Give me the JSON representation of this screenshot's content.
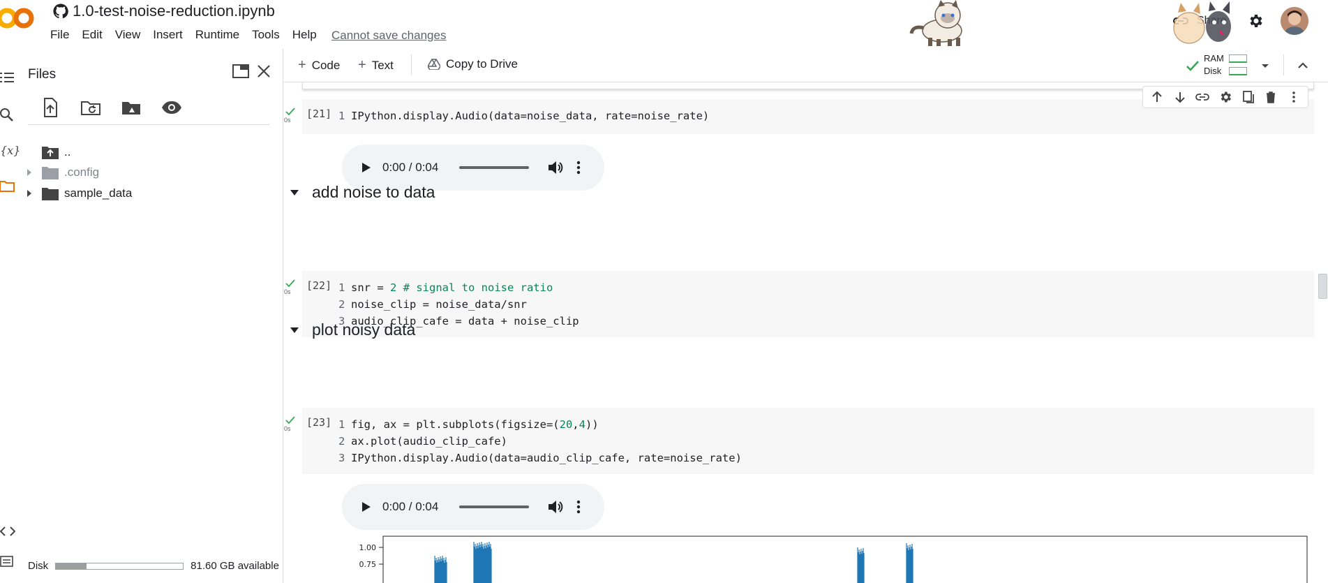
{
  "header": {
    "notebook_title": "1.0-test-noise-reduction.ipynb",
    "menu": [
      "File",
      "Edit",
      "View",
      "Insert",
      "Runtime",
      "Tools",
      "Help"
    ],
    "cannot_save": "Cannot save changes",
    "share_label": "Share"
  },
  "files_panel": {
    "title": "Files",
    "tree": [
      {
        "label": "..",
        "type": "parent"
      },
      {
        "label": ".config",
        "type": "folder-dim"
      },
      {
        "label": "sample_data",
        "type": "folder"
      }
    ],
    "disk_label": "Disk",
    "disk_available": "81.60 GB available",
    "disk_used_fraction": 0.24
  },
  "toolbar": {
    "code_label": "Code",
    "text_label": "Text",
    "copy_to_drive": "Copy to Drive",
    "ram_label": "RAM",
    "disk_label": "Disk"
  },
  "cells": {
    "c21": {
      "count": "[21]",
      "time": "0s",
      "lines": [
        "IPython.display.Audio(data=noise_data, rate=noise_rate)"
      ]
    },
    "audio1": {
      "time": "0:00 / 0:04"
    },
    "section1": "add noise to data",
    "c22": {
      "count": "[22]",
      "time": "0s",
      "lines": [
        {
          "pre": "snr = ",
          "num": "2",
          "cmt": " # signal to noise ratio"
        },
        "noise_clip = noise_data/snr",
        "audio_clip_cafe = data + noise_clip"
      ]
    },
    "section2": "plot noisy data",
    "c23": {
      "count": "[23]",
      "time": "0s",
      "lines": [
        {
          "pre": "fig, ax = plt.subplots(figsize=(",
          "a": "20",
          "mid": ",",
          "b": "4",
          "post": "))"
        },
        "ax.plot(audio_clip_cafe)",
        "IPython.display.Audio(data=audio_clip_cafe, rate=noise_rate)"
      ]
    },
    "audio2": {
      "time": "0:00 / 0:04"
    }
  },
  "plot": {
    "ytick_1": "1.00",
    "ytick_2": "0.75",
    "series_color": "#1f77b4"
  },
  "colors": {
    "accent_orange": "#F9AB00",
    "check_green": "#34a853"
  }
}
